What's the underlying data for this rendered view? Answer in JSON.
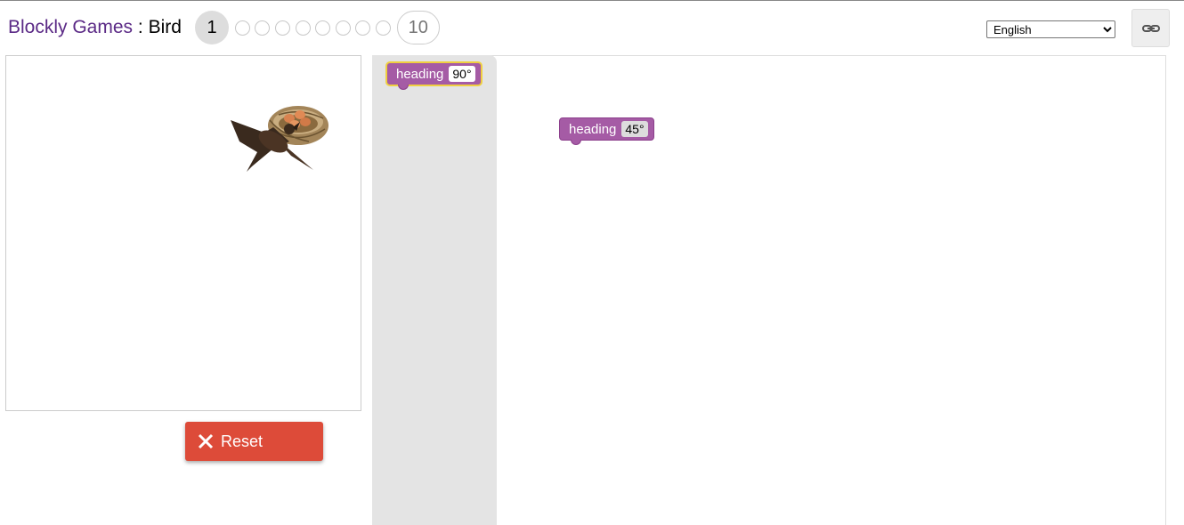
{
  "header": {
    "app_name": "Blockly Games",
    "separator": " : ",
    "game_name": "Bird",
    "levels": {
      "current": "1",
      "last": "10"
    },
    "language": "English"
  },
  "toolbox": {
    "block_label": "heading",
    "block_value": "90°"
  },
  "workspace": {
    "block_label": "heading",
    "block_value": "45°"
  },
  "controls": {
    "reset_label": "Reset"
  },
  "colors": {
    "block": "#a55ba5",
    "reset": "#dd4b39",
    "title": "#5b2a86"
  }
}
